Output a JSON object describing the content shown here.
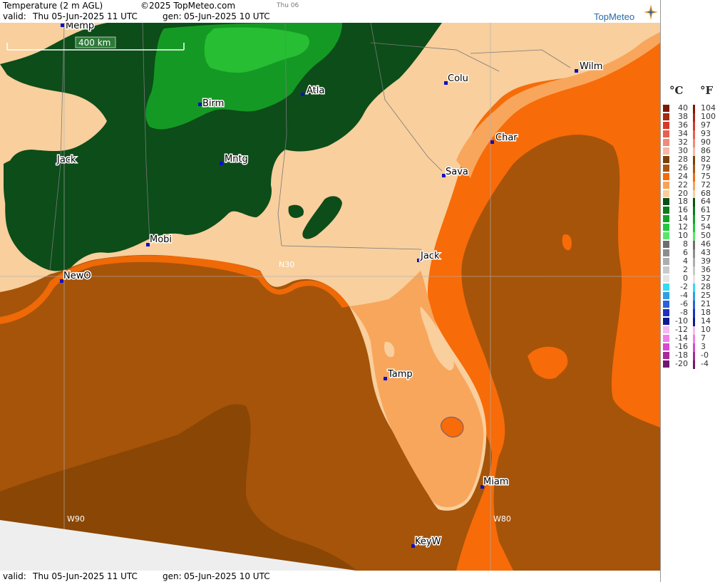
{
  "header": {
    "title": "Temperature (2 m AGL)",
    "copyright": "©2025 TopMeteo.com",
    "small_day": "Thu 06",
    "valid_label": "valid:",
    "valid_value": "Thu   05-Jun-2025  11 UTC",
    "gen_label": "gen:",
    "gen_value": "05-Jun-2025 10 UTC"
  },
  "logo": {
    "brand": "TopMeteo"
  },
  "footer": {
    "valid_label": "valid:",
    "valid_value": "Thu   05-Jun-2025  11 UTC",
    "gen_label": "gen:",
    "gen_value": "05-Jun-2025 10 UTC"
  },
  "map": {
    "scale_label": "400 km",
    "grid_labels": {
      "lat": "N30",
      "lon_west": "W90",
      "lon_east": "W80"
    },
    "cities": [
      "Memp",
      "Birm",
      "Atla",
      "Colu",
      "Wilm",
      "Char",
      "Jack",
      "Mntg",
      "Sava",
      "Mobi",
      "Jack",
      "NewO",
      "Tamp",
      "Miam",
      "KeyW"
    ]
  },
  "legend": {
    "unit_c": "°C",
    "unit_f": "°F",
    "rows": [
      {
        "c": "40",
        "f": "104",
        "color": "#7a1a00"
      },
      {
        "c": "38",
        "f": "100",
        "color": "#a52a10"
      },
      {
        "c": "36",
        "f": "97",
        "color": "#d43a2a"
      },
      {
        "c": "34",
        "f": "93",
        "color": "#e8604e"
      },
      {
        "c": "32",
        "f": "90",
        "color": "#f08a7a"
      },
      {
        "c": "30",
        "f": "86",
        "color": "#f6b7a8"
      },
      {
        "c": "28",
        "f": "82",
        "color": "#7a4206"
      },
      {
        "c": "26",
        "f": "79",
        "color": "#a8560f"
      },
      {
        "c": "24",
        "f": "75",
        "color": "#f66a08"
      },
      {
        "c": "22",
        "f": "72",
        "color": "#f7a25a"
      },
      {
        "c": "20",
        "f": "68",
        "color": "#f8cf9a"
      },
      {
        "c": "18",
        "f": "64",
        "color": "#0b4f18"
      },
      {
        "c": "16",
        "f": "61",
        "color": "#0e7a1d"
      },
      {
        "c": "14",
        "f": "57",
        "color": "#13a324"
      },
      {
        "c": "12",
        "f": "54",
        "color": "#22c93a"
      },
      {
        "c": "10",
        "f": "50",
        "color": "#58e66a"
      },
      {
        "c": "8",
        "f": "46",
        "color": "#6e6e6e"
      },
      {
        "c": "6",
        "f": "43",
        "color": "#8d8d8d"
      },
      {
        "c": "4",
        "f": "39",
        "color": "#adadad"
      },
      {
        "c": "2",
        "f": "36",
        "color": "#c9c9c9"
      },
      {
        "c": "0",
        "f": "32",
        "color": "#e4e4e4"
      },
      {
        "c": "-2",
        "f": "28",
        "color": "#38d8f0"
      },
      {
        "c": "-4",
        "f": "25",
        "color": "#2c9fe8"
      },
      {
        "c": "-6",
        "f": "21",
        "color": "#2a62d8"
      },
      {
        "c": "-8",
        "f": "18",
        "color": "#1e2fc0"
      },
      {
        "c": "-10",
        "f": "14",
        "color": "#101a8c"
      },
      {
        "c": "-12",
        "f": "10",
        "color": "#f6b8f2"
      },
      {
        "c": "-14",
        "f": "7",
        "color": "#ee80e8"
      },
      {
        "c": "-16",
        "f": "3",
        "color": "#d848d0"
      },
      {
        "c": "-18",
        "f": "-0",
        "color": "#a8289e"
      },
      {
        "c": "-20",
        "f": "-4",
        "color": "#701870"
      }
    ]
  },
  "colors": {
    "deep_brown": "#8a4604",
    "brown": "#a65409",
    "orange": "#f76b08",
    "light_orange": "#f8a65c",
    "tan": "#f8cf9d",
    "dark_green": "#0c4d19",
    "green": "#149a24",
    "lightgreen": "#27be33"
  }
}
